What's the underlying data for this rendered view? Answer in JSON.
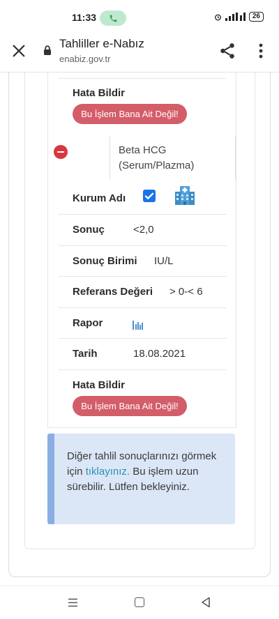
{
  "status_bar": {
    "time": "11:33",
    "battery": "26"
  },
  "browser": {
    "title": "Tahliller e-Nabız",
    "url": "enabiz.gov.tr"
  },
  "record": {
    "top_error_label": "Hata Bildir",
    "top_error_button": "Bu İşlem Bana Ait Değil!",
    "test_name": "Beta HCG (Serum/Plazma)",
    "fields": {
      "institution_label": "Kurum Adı",
      "result_label": "Sonuç",
      "result_value": "<2,0",
      "unit_label": "Sonuç Birimi",
      "unit_value": "IU/L",
      "reference_label": "Referans Değeri",
      "reference_value": "> 0-< 6",
      "report_label": "Rapor",
      "date_label": "Tarih",
      "date_value": "18.08.2021"
    },
    "bottom_error_label": "Hata Bildir",
    "bottom_error_button": "Bu İşlem Bana Ait Değil!"
  },
  "info": {
    "text_before": "Diğer tahlil sonuçlarınızı görmek için ",
    "link": "tıklayınız.",
    "text_after": " Bu işlem uzun sürebilir. Lütfen bekleyiniz."
  },
  "colors": {
    "error_button": "#d35d69",
    "minus_icon": "#d9363e",
    "checkbox": "#1a73e8",
    "info_bg": "#dbe6f7",
    "info_border": "#8aaee3",
    "link": "#2f8fb8"
  }
}
